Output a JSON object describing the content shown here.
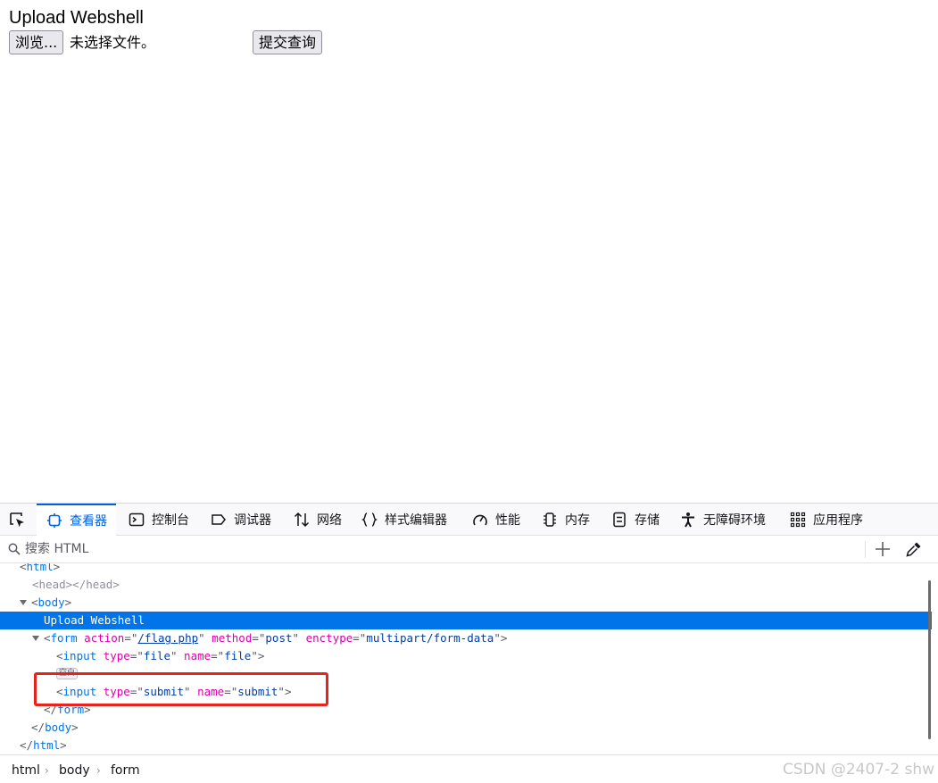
{
  "page": {
    "title": "Upload Webshell",
    "browse_button": "浏览...",
    "file_status": "未选择文件。",
    "submit_button": "提交查询"
  },
  "devtools": {
    "tabs": [
      {
        "label": "查看器",
        "icon": "inspector-icon",
        "active": true
      },
      {
        "label": "控制台",
        "icon": "console-icon"
      },
      {
        "label": "调试器",
        "icon": "debugger-icon"
      },
      {
        "label": "网络",
        "icon": "network-icon"
      },
      {
        "label": "样式编辑器",
        "icon": "style-editor-icon"
      },
      {
        "label": "性能",
        "icon": "performance-icon"
      },
      {
        "label": "内存",
        "icon": "memory-icon"
      },
      {
        "label": "存储",
        "icon": "storage-icon"
      },
      {
        "label": "无障碍环境",
        "icon": "accessibility-icon"
      },
      {
        "label": "应用程序",
        "icon": "application-icon"
      }
    ],
    "search_placeholder": "搜索 HTML",
    "tree": {
      "html_open": "html",
      "head": "head",
      "body": "body",
      "text_node": "Upload Webshell",
      "form": {
        "tag": "form",
        "action_attr": "action",
        "action_val": "/flag.php",
        "method_attr": "method",
        "method_val": "post",
        "enctype_attr": "enctype",
        "enctype_val": "multipart/form-data"
      },
      "input_file": {
        "tag": "input",
        "type_attr": "type",
        "type_val": "file",
        "name_attr": "name",
        "name_val": "file"
      },
      "whitespace_badge": "空白",
      "input_submit": {
        "tag": "input",
        "type_attr": "type",
        "type_val": "submit",
        "name_attr": "name",
        "name_val": "submit"
      },
      "form_close": "form",
      "body_close": "body",
      "html_close": "html"
    },
    "breadcrumbs": [
      "html",
      "body",
      "form"
    ],
    "watermark": "CSDN @2407-2 shw"
  },
  "colors": {
    "accent": "#0074e8",
    "highlight_box": "#e8231b"
  }
}
